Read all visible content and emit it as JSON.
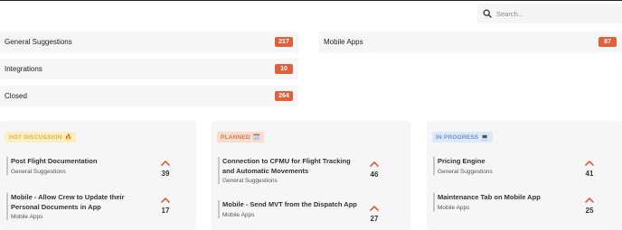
{
  "search": {
    "placeholder": "Search...",
    "icon": "search-icon"
  },
  "categories": [
    {
      "label": "General Suggestions",
      "count": "217"
    },
    {
      "label": "Mobile Apps",
      "count": "87"
    },
    {
      "label": "Integrations",
      "count": "10"
    },
    {
      "label": "Closed",
      "count": "264"
    }
  ],
  "columns": [
    {
      "tag": "HOT DISCUSSION",
      "emoji": "🔥",
      "cards": [
        {
          "title": "Post Flight Documentation",
          "category": "General Suggestions",
          "votes": "39"
        },
        {
          "title": "Mobile - Allow Crew to Update their Personal Documents in App",
          "category": "Mobile Apps",
          "votes": "17"
        }
      ]
    },
    {
      "tag": "PLANNED",
      "emoji": "🗓️",
      "cards": [
        {
          "title": "Connection to CFMU for Flight Tracking and Automatic Movements",
          "category": "General Suggestions",
          "votes": "46"
        },
        {
          "title": "Mobile - Send MVT from the Dispatch App",
          "category": "Mobile Apps",
          "votes": "27"
        }
      ]
    },
    {
      "tag": "IN PROGRESS",
      "emoji": "💻",
      "cards": [
        {
          "title": "Pricing Engine",
          "category": "General Suggestions",
          "votes": "41"
        },
        {
          "title": "Maintenance Tab on Mobile App",
          "category": "Mobile Apps",
          "votes": "25"
        }
      ]
    }
  ],
  "colors": {
    "accent": "#e0603c",
    "panel": "#f6f6f6"
  }
}
